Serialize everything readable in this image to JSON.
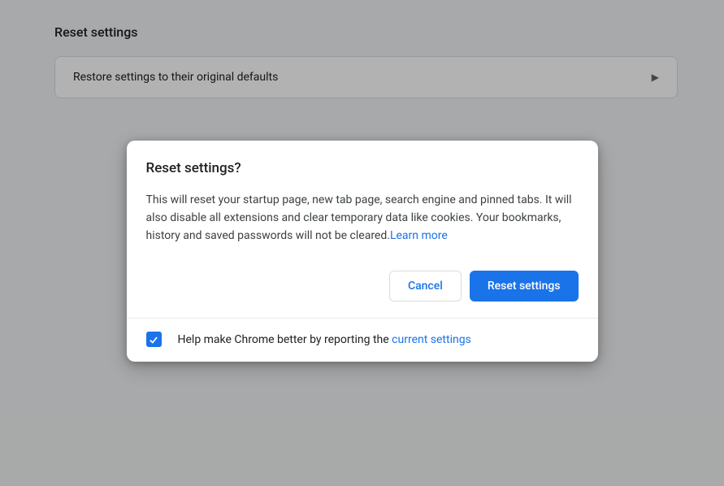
{
  "background": {
    "section_title": "Reset settings",
    "row_label": "Restore settings to their original defaults"
  },
  "dialog": {
    "title": "Reset settings?",
    "description": "This will reset your startup page, new tab page, search engine and pinned tabs. It will also disable all extensions and clear temporary data like cookies. Your bookmarks, history and saved passwords will not be cleared.",
    "learn_more": "Learn more",
    "cancel_label": "Cancel",
    "confirm_label": "Reset settings",
    "footer_prefix": "Help make Chrome better by reporting the ",
    "footer_link": "current settings",
    "checkbox_checked": true
  }
}
